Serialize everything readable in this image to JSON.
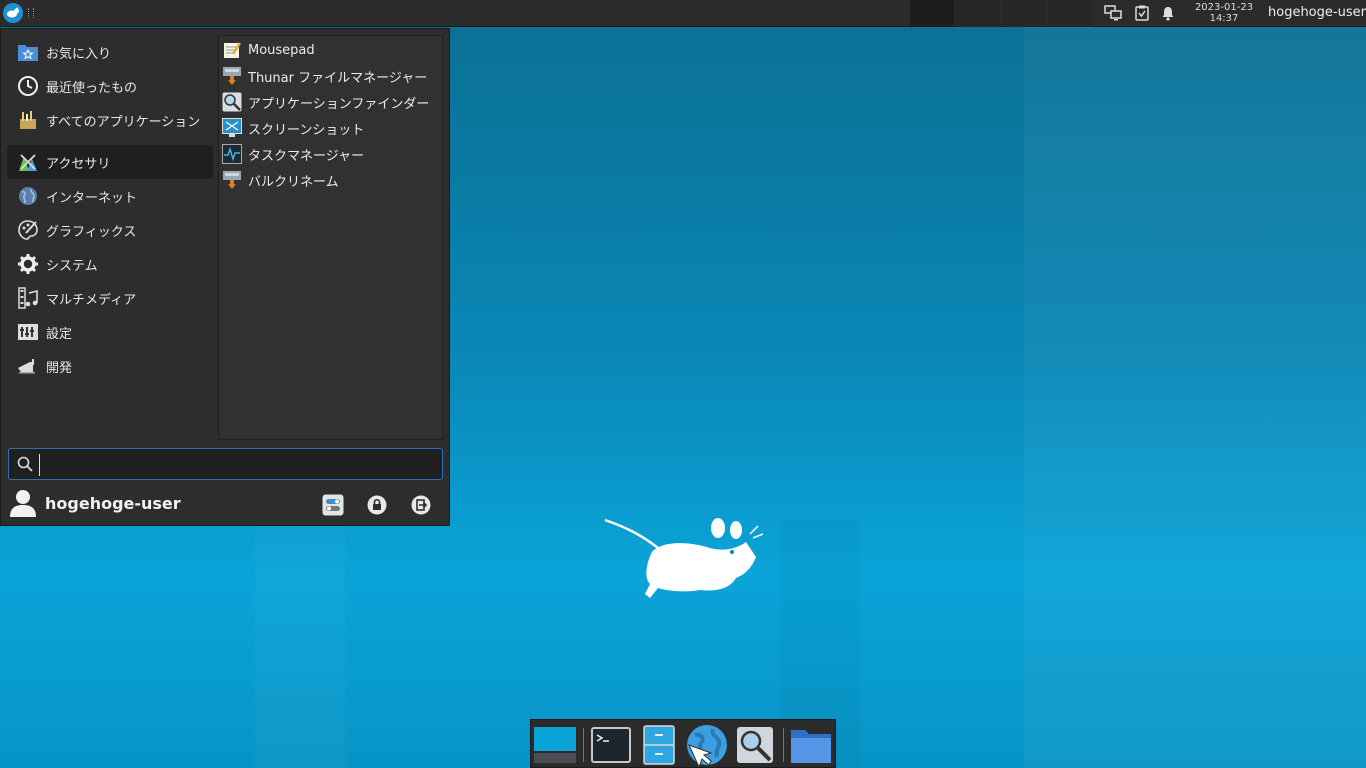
{
  "panel": {
    "clock_date": "2023-01-23",
    "clock_time": "14:37",
    "user": "hogehoge-user"
  },
  "menu": {
    "categories": [
      {
        "label": "お気に入り",
        "icon": "favorites-icon"
      },
      {
        "label": "最近使ったもの",
        "icon": "recent-icon"
      },
      {
        "label": "すべてのアプリケーション",
        "icon": "all-apps-icon"
      },
      {
        "label": "アクセサリ",
        "icon": "accessories-icon",
        "active": true
      },
      {
        "label": "インターネット",
        "icon": "internet-icon"
      },
      {
        "label": "グラフィックス",
        "icon": "graphics-icon"
      },
      {
        "label": "システム",
        "icon": "system-icon"
      },
      {
        "label": "マルチメディア",
        "icon": "multimedia-icon"
      },
      {
        "label": "設定",
        "icon": "settings-icon"
      },
      {
        "label": "開発",
        "icon": "development-icon"
      }
    ],
    "apps": [
      {
        "label": "Mousepad",
        "icon": "mousepad-icon"
      },
      {
        "label": "Thunar ファイルマネージャー",
        "icon": "thunar-icon"
      },
      {
        "label": "アプリケーションファインダー",
        "icon": "appfinder-icon"
      },
      {
        "label": "スクリーンショット",
        "icon": "screenshot-icon"
      },
      {
        "label": "タスクマネージャー",
        "icon": "taskmanager-icon"
      },
      {
        "label": "バルクリネーム",
        "icon": "bulk-rename-icon"
      }
    ],
    "search": {
      "value": "",
      "placeholder": ""
    },
    "user_name": "hogehoge-user"
  },
  "colors": {
    "accent": "#2f6db6",
    "panel_bg": "#2b2b2b",
    "menu_bg": "#2d2d2d",
    "desktop_top": "#0b6f93",
    "desktop_bottom": "#0aa4d8"
  },
  "dock": {
    "items": [
      {
        "name": "show-desktop-icon"
      },
      {
        "name": "terminal-icon"
      },
      {
        "name": "file-manager-icon"
      },
      {
        "name": "web-browser-icon"
      },
      {
        "name": "app-finder-icon"
      },
      {
        "name": "home-folder-icon"
      }
    ]
  }
}
